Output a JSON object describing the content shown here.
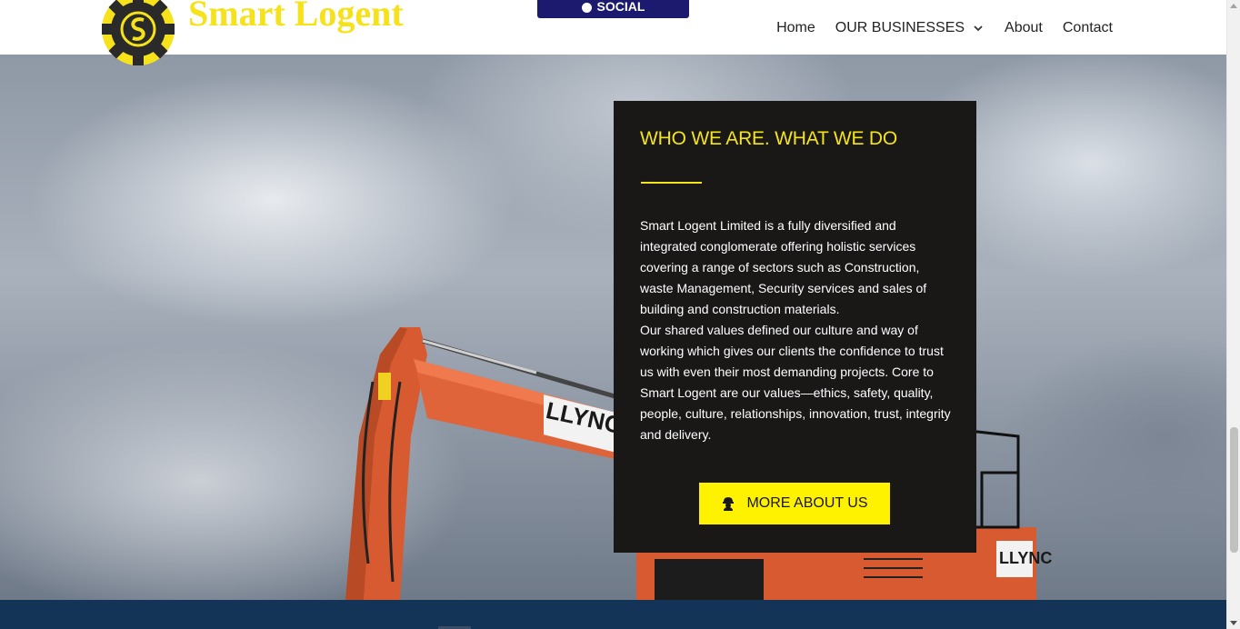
{
  "header": {
    "brand": "Smart Logent",
    "top_button_label": "SOCIAL",
    "nav": [
      {
        "label": "Home"
      },
      {
        "label": "OUR BUSINESSES",
        "has_dropdown": true
      },
      {
        "label": "About"
      },
      {
        "label": "Contact"
      }
    ]
  },
  "card": {
    "heading": "WHO WE ARE. WHAT WE DO",
    "paragraph_1": "Smart Logent Limited is a fully diversified and integrated conglomerate offering holistic services covering a range of sectors such as Construction, waste Management, Security services and sales of building and construction materials.",
    "paragraph_2": "Our shared values defined our culture and way of working which gives our clients the confidence to trust us with even their most demanding projects. Core to Smart Logent are our values—ethics, safety, quality, people, culture, relationships, innovation, trust, integrity and delivery.",
    "button_label": "MORE ABOUT US",
    "button_icon": "worker-icon"
  },
  "hero": {
    "excavator_brand": "LLYNCH",
    "excavator_brand_2": "LLYNC"
  },
  "colors": {
    "accent": "#f4e41a",
    "card_bg": "#1a1717",
    "button_bg": "#fff200",
    "top_button_bg": "#1b1a6e",
    "footer_bg": "#133456",
    "excavator": "#e0643a"
  }
}
